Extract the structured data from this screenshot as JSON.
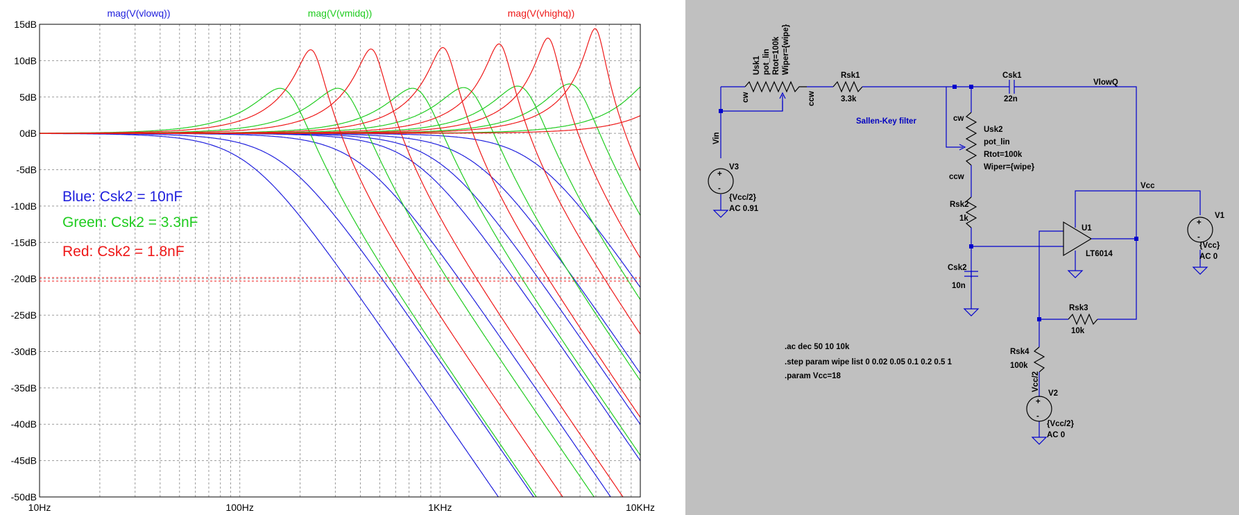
{
  "colors": {
    "blue": "#2020dd",
    "green": "#20cc20",
    "red": "#ee1818",
    "wire": "#0000cc",
    "schematic_bg": "#c0c0c0",
    "grid": "#9a9a9a"
  },
  "traces": {
    "blue": "mag(V(vlowq))",
    "green": "mag(V(vmidq))",
    "red": "mag(V(vhighq))"
  },
  "legend": {
    "blue": "Blue: Csk2 = 10nF",
    "green": "Green: Csk2 = 3.3nF",
    "red": "Red: Csk2 = 1.8nF"
  },
  "chart_data": {
    "type": "line",
    "xscale": "log",
    "xlim": [
      10,
      10000
    ],
    "ylim": [
      -50,
      15
    ],
    "xticks": [
      "10Hz",
      "100Hz",
      "1KHz",
      "10KHz"
    ],
    "yticks": [
      "15dB",
      "10dB",
      "5dB",
      "0dB",
      "-5dB",
      "-10dB",
      "-15dB",
      "-20dB",
      "-25dB",
      "-30dB",
      "-35dB",
      "-40dB",
      "-45dB",
      "-50dB"
    ],
    "grid": true,
    "series": [
      {
        "name": "mag(V(vlowq))",
        "color": "#2020dd",
        "traces": [
          {
            "f0": 110,
            "peak_db": 0
          },
          {
            "f0": 165,
            "peak_db": 0
          },
          {
            "f0": 400,
            "peak_db": 0
          },
          {
            "f0": 750,
            "peak_db": 0
          },
          {
            "f0": 1000,
            "peak_db": 0
          },
          {
            "f0": 1500,
            "peak_db": 0
          },
          {
            "f0": 3000,
            "peak_db": 0
          }
        ]
      },
      {
        "name": "mag(V(vmidq))",
        "color": "#20cc20",
        "traces": [
          {
            "f0": 170,
            "peak_db": 6.2
          },
          {
            "f0": 330,
            "peak_db": 6.2
          },
          {
            "f0": 780,
            "peak_db": 6.2
          },
          {
            "f0": 1400,
            "peak_db": 6.3
          },
          {
            "f0": 2600,
            "peak_db": 6.5
          },
          {
            "f0": 4700,
            "peak_db": 6.8
          },
          {
            "f0": 12000,
            "peak_db": 7.3
          }
        ]
      },
      {
        "name": "mag(V(vhighq))",
        "color": "#ee1818",
        "traces": [
          {
            "f0": 230,
            "peak_db": 11.5
          },
          {
            "f0": 460,
            "peak_db": 11.6
          },
          {
            "f0": 1050,
            "peak_db": 11.8
          },
          {
            "f0": 2000,
            "peak_db": 12.3
          },
          {
            "f0": 3500,
            "peak_db": 13.1
          },
          {
            "f0": 6000,
            "peak_db": 14.4
          },
          {
            "f0": 20000,
            "peak_db": 15
          }
        ]
      }
    ]
  },
  "schematic": {
    "usk1": {
      "name": "Usk1",
      "model": "pot_lin",
      "rtot": "Rtot=100k",
      "wiper": "Wiper={wipe}",
      "cw": "cw",
      "ccw": "ccw"
    },
    "rsk1": {
      "name": "Rsk1",
      "value": "3.3k"
    },
    "csk1": {
      "name": "Csk1",
      "value": "22n"
    },
    "vlowq_label": "VlowQ",
    "vin_label": "Vin",
    "comment": "Sallen-Key filter",
    "usk2": {
      "name": "Usk2",
      "model": "pot_lin",
      "rtot": "Rtot=100k",
      "wiper": "Wiper={wipe}",
      "cw": "cw",
      "ccw": "ccw"
    },
    "v3": {
      "name": "V3",
      "value": "{Vcc/2}",
      "ac": "AC 0.91"
    },
    "rsk2": {
      "name": "Rsk2",
      "value": "1k"
    },
    "csk2": {
      "name": "Csk2",
      "value": "10n"
    },
    "vcc_label": "Vcc",
    "v1": {
      "name": "V1",
      "value": "{Vcc}",
      "ac": "AC 0"
    },
    "u1": {
      "name": "U1",
      "model": "LT6014"
    },
    "rsk3": {
      "name": "Rsk3",
      "value": "10k"
    },
    "rsk4": {
      "name": "Rsk4",
      "value": "100k"
    },
    "vcc2_label": "Vcc/2",
    "v2": {
      "name": "V2",
      "value": "{Vcc/2}",
      "ac": "AC 0"
    },
    "directives": [
      ".ac dec 50 10 10k",
      ".step param wipe list 0 0.02 0.05 0.1 0.2 0.5 1",
      ".param Vcc=18"
    ]
  }
}
